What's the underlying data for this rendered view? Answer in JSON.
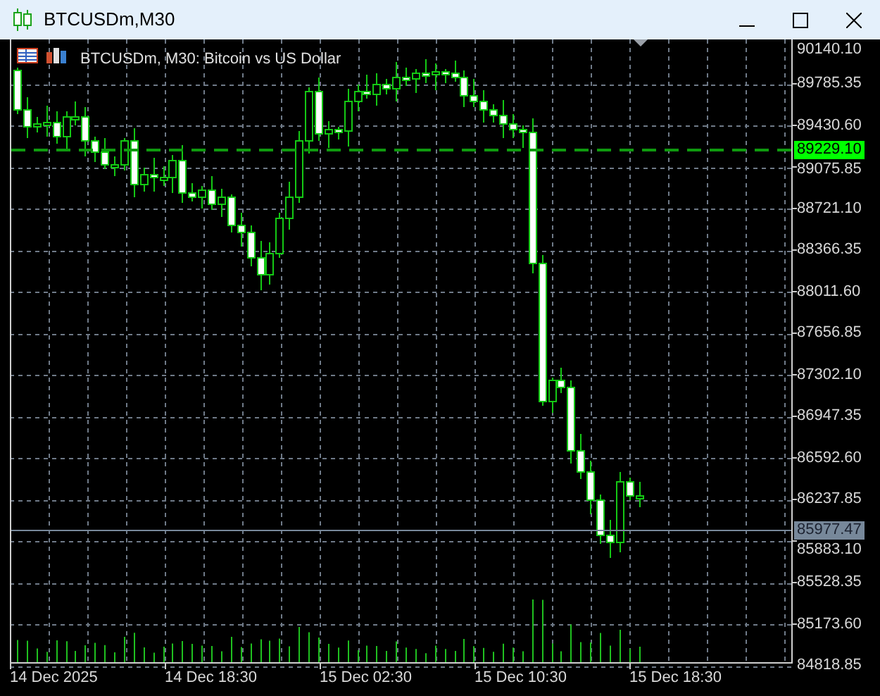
{
  "window": {
    "title": "BTCUSDm,M30"
  },
  "chart": {
    "symbol_label": "BTCUSDm, M30:  Bitcoin vs US Dollar",
    "price_axis": [
      "90140.10",
      "89785.35",
      "89430.60",
      "89075.85",
      "88721.10",
      "88366.35",
      "88011.60",
      "87656.85",
      "87302.10",
      "86947.35",
      "86592.60",
      "86237.85",
      "85883.10",
      "85528.35",
      "85173.60",
      "84818.85"
    ],
    "time_axis": [
      "14 Dec 2025",
      "14 Dec 18:30",
      "15 Dec 02:30",
      "15 Dec 10:30",
      "15 Dec 18:30"
    ],
    "bid_price": "89229.10",
    "last_price": "85977.47"
  }
}
